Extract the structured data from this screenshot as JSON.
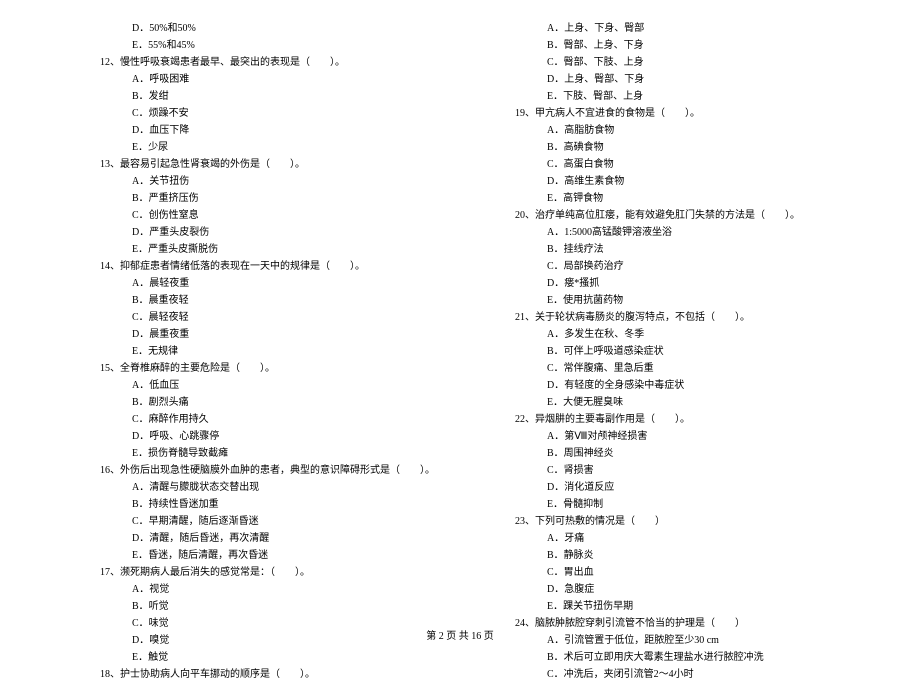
{
  "leftColumn": {
    "startOptions": [
      "D．50%和50%",
      "E．55%和45%"
    ],
    "questions": [
      {
        "num": "12、",
        "text": "慢性呼吸衰竭患者最早、最突出的表现是（　　）。",
        "options": [
          "A．呼吸困难",
          "B．发绀",
          "C．烦躁不安",
          "D．血压下降",
          "E．少尿"
        ]
      },
      {
        "num": "13、",
        "text": "最容易引起急性肾衰竭的外伤是（　　）。",
        "options": [
          "A．关节扭伤",
          "B．严重挤压伤",
          "C．创伤性窒息",
          "D．严重头皮裂伤",
          "E．严重头皮撕脱伤"
        ]
      },
      {
        "num": "14、",
        "text": "抑郁症患者情绪低落的表现在一天中的规律是（　　）。",
        "options": [
          "A．晨轻夜重",
          "B．晨重夜轻",
          "C．晨轻夜轻",
          "D．晨重夜重",
          "E．无规律"
        ]
      },
      {
        "num": "15、",
        "text": "全脊椎麻醉的主要危险是（　　）。",
        "options": [
          "A．低血压",
          "B．剧烈头痛",
          "C．麻醉作用持久",
          "D．呼吸、心跳骤停",
          "E．损伤脊髓导致截瘫"
        ]
      },
      {
        "num": "16、",
        "text": "外伤后出现急性硬脑膜外血肿的患者，典型的意识障碍形式是（　　）。",
        "options": [
          "A．清醒与朦胧状态交替出现",
          "B．持续性昏迷加重",
          "C．早期清醒，随后逐渐昏迷",
          "D．清醒，随后昏迷，再次清醒",
          "E．昏迷，随后清醒，再次昏迷"
        ]
      },
      {
        "num": "17、",
        "text": "濒死期病人最后消失的感觉常是：（　　）。",
        "options": [
          "A．视觉",
          "B．听觉",
          "C．味觉",
          "D．嗅觉",
          "E．触觉"
        ]
      },
      {
        "num": "18、",
        "text": "护士协助病人向平车挪动的顺序是（　　）。",
        "options": []
      }
    ]
  },
  "rightColumn": {
    "startOptions": [
      "A．上身、下身、臀部",
      "B．臀部、上身、下身",
      "C．臀部、下肢、上身",
      "D．上身、臀部、下身",
      "E．下肢、臀部、上身"
    ],
    "questions": [
      {
        "num": "19、",
        "text": "甲亢病人不宜进食的食物是（　　）。",
        "options": [
          "A．高脂肪食物",
          "B．高碘食物",
          "C．高蛋白食物",
          "D．高维生素食物",
          "E．高钾食物"
        ]
      },
      {
        "num": "20、",
        "text": "治疗单纯高位肛瘘，能有效避免肛门失禁的方法是（　　）。",
        "options": [
          "A．1:5000高锰酸钾溶液坐浴",
          "B．挂线疗法",
          "C．局部换药治疗",
          "D．瘘*搔抓",
          "E．使用抗菌药物"
        ]
      },
      {
        "num": "21、",
        "text": "关于轮状病毒肠炎的腹泻特点，不包括（　　）。",
        "options": [
          "A．多发生在秋、冬季",
          "B．可伴上呼吸道感染症状",
          "C．常伴腹痛、里急后重",
          "D．有轻度的全身感染中毒症状",
          "E．大便无腥臭味"
        ]
      },
      {
        "num": "22、",
        "text": "异烟肼的主要毒副作用是（　　）。",
        "options": [
          "A．第Ⅷ对颅神经损害",
          "B．周围神经炎",
          "C．肾损害",
          "D．消化道反应",
          "E．骨髓抑制"
        ]
      },
      {
        "num": "23、",
        "text": "下列可热敷的情况是（　　）",
        "options": [
          "A．牙痛",
          "B．静脉炎",
          "C．胃出血",
          "D．急腹症",
          "E．踝关节扭伤早期"
        ]
      },
      {
        "num": "24、",
        "text": "脑脓肿脓腔穿刺引流管不恰当的护理是（　　）",
        "options": [
          "A．引流管置于低位，距脓腔至少30 cm",
          "B．术后可立即用庆大霉素生理盐水进行脓腔冲洗",
          "C．冲洗后，夹闭引流管2～4小时"
        ]
      }
    ]
  },
  "footer": {
    "text": "第 2 页 共 16 页"
  }
}
